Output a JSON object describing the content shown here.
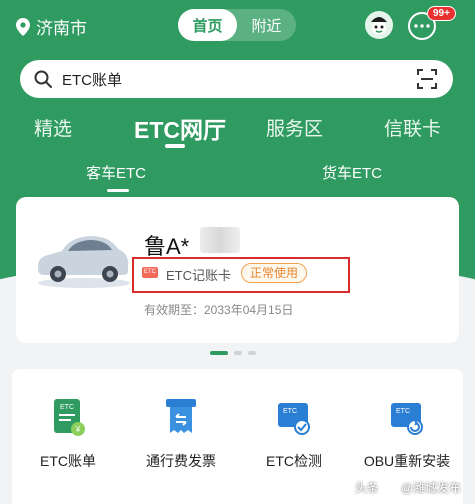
{
  "colors": {
    "brand_green": "#2f9b61",
    "highlight_red": "#d92b2b",
    "status_orange": "#e8862d",
    "badge_red": "#e8312f"
  },
  "header": {
    "location": "济南市",
    "segments": [
      {
        "label": "首页",
        "active": true
      },
      {
        "label": "附近",
        "active": false
      }
    ],
    "message_badge": "99+",
    "icons": {
      "location": "location-pin-icon",
      "avatar": "mascot-avatar-icon",
      "messages": "chat-bubble-icon"
    }
  },
  "search": {
    "text": "ETC账单",
    "icons": {
      "search": "search-icon",
      "scan": "scan-icon"
    }
  },
  "main_tabs": [
    {
      "label": "精选",
      "active": false
    },
    {
      "label": "ETC网厅",
      "active": true
    },
    {
      "label": "服务区",
      "active": false
    },
    {
      "label": "信联卡",
      "active": false
    }
  ],
  "sub_tabs": [
    {
      "label": "客车ETC",
      "active": true
    },
    {
      "label": "货车ETC",
      "active": false
    }
  ],
  "vehicle_card": {
    "plate": "鲁A*",
    "card_type": "ETC记账卡",
    "status": "正常使用",
    "expiry": "有效期至：2033年04月15日",
    "icons": {
      "car": "car-icon",
      "card": "etc-card-icon"
    }
  },
  "pager": {
    "total": 3,
    "active_index": 0
  },
  "services": [
    {
      "label": "ETC账单",
      "icon": "etc-bill-icon"
    },
    {
      "label": "通行费发票",
      "icon": "toll-invoice-icon"
    },
    {
      "label": "ETC检测",
      "icon": "etc-check-icon"
    },
    {
      "label": "OBU重新安装",
      "icon": "obu-reinstall-icon"
    }
  ],
  "watermark": {
    "prefix": "头条",
    "author": "@潍城发布"
  }
}
